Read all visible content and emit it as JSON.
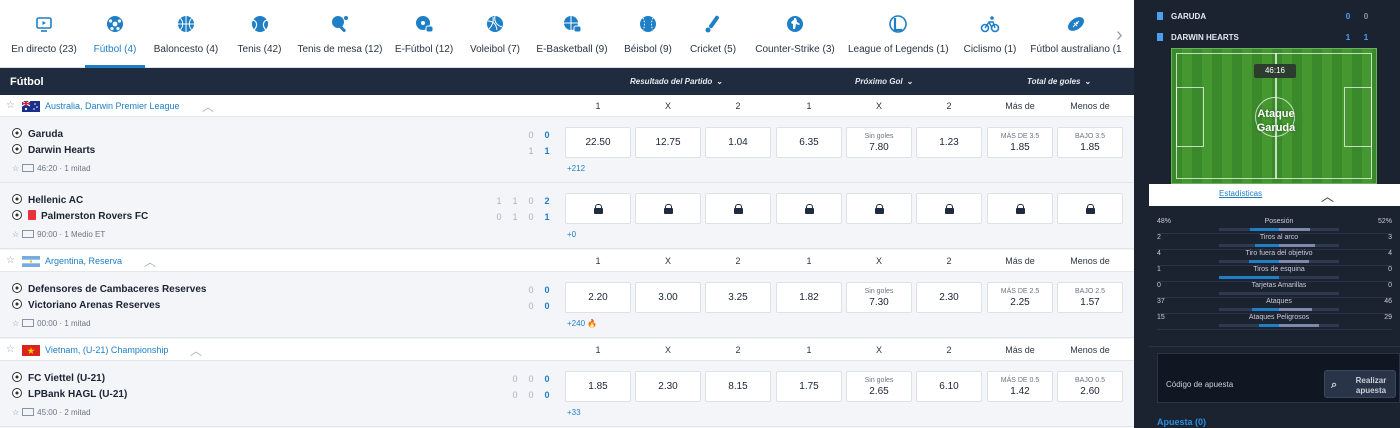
{
  "sports_nav": [
    {
      "label": "En directo (23)",
      "icon": "live-tv-icon"
    },
    {
      "label": "Fútbol (4)",
      "icon": "soccer-ball-icon",
      "active": true
    },
    {
      "label": "Baloncesto (4)",
      "icon": "basketball-icon"
    },
    {
      "label": "Tenis (42)",
      "icon": "tennis-ball-icon"
    },
    {
      "label": "Tenis de mesa (12)",
      "icon": "table-tennis-icon"
    },
    {
      "label": "E-Fútbol (12)",
      "icon": "esoccer-icon"
    },
    {
      "label": "Voleibol (7)",
      "icon": "volleyball-icon"
    },
    {
      "label": "E-Basketball (9)",
      "icon": "ebasketball-icon"
    },
    {
      "label": "Béisbol (9)",
      "icon": "baseball-icon"
    },
    {
      "label": "Cricket (5)",
      "icon": "cricket-icon"
    },
    {
      "label": "Counter-Strike (3)",
      "icon": "counter-strike-icon"
    },
    {
      "label": "League of Legends (1)",
      "icon": "league-of-legends-icon"
    },
    {
      "label": "Ciclismo (1)",
      "icon": "cycling-icon"
    },
    {
      "label": "Fútbol australiano (1",
      "icon": "australian-football-icon"
    }
  ],
  "market_header": {
    "title": "Fútbol",
    "markets": [
      "Resultado del Partido",
      "Próximo Gol",
      "Total de goles"
    ]
  },
  "leagues": [
    {
      "name": "Australia, Darwin Premier League",
      "flag": "australia",
      "columns": [
        "1",
        "X",
        "2",
        "1",
        "X",
        "2",
        "Más de",
        "Menos de"
      ]
    },
    {
      "name": "Argentina, Reserva",
      "flag": "argentina",
      "columns": [
        "1",
        "X",
        "2",
        "1",
        "X",
        "2",
        "Más de",
        "Menos de"
      ]
    },
    {
      "name": "Vietnam, (U-21) Championship",
      "flag": "vietnam",
      "columns": [
        "1",
        "X",
        "2",
        "1",
        "X",
        "2",
        "Más de",
        "Menos de"
      ]
    }
  ],
  "events": [
    {
      "home": "Garuda",
      "away": "Darwin Hearts",
      "time": "46:20",
      "period": "1 mitad",
      "home_scores": [
        "0",
        "0"
      ],
      "away_scores": [
        "1",
        "1"
      ],
      "odds": [
        {
          "v": "22.50"
        },
        {
          "v": "12.75"
        },
        {
          "v": "1.04"
        },
        {
          "v": "6.35"
        },
        {
          "sub": "Sin goles",
          "v": "7.80"
        },
        {
          "v": "1.23"
        },
        {
          "sub": "MÁS DE 3.5",
          "v": "1.85"
        },
        {
          "sub": "BAJO 3.5",
          "v": "1.85"
        }
      ],
      "more": "+212"
    },
    {
      "home": "Hellenic AC",
      "away": "Palmerston Rovers FC",
      "time": "90:00",
      "period": "1 Medio ET",
      "home_scores": [
        "1",
        "1",
        "0",
        "2"
      ],
      "away_scores": [
        "0",
        "1",
        "0",
        "1"
      ],
      "locked": true,
      "more": "+0"
    },
    {
      "home": "Defensores de Cambaceres Reserves",
      "away": "Victoriano Arenas Reserves",
      "time": "00:00",
      "period": "1 mitad",
      "home_scores": [
        "0",
        "0"
      ],
      "away_scores": [
        "0",
        "0"
      ],
      "odds": [
        {
          "v": "2.20"
        },
        {
          "v": "3.00"
        },
        {
          "v": "3.25"
        },
        {
          "v": "1.82"
        },
        {
          "sub": "Sin goles",
          "v": "7.30"
        },
        {
          "v": "2.30"
        },
        {
          "sub": "MÁS DE 2.5",
          "v": "2.25"
        },
        {
          "sub": "BAJO 2.5",
          "v": "1.57"
        }
      ],
      "more": "+240"
    },
    {
      "home": "FC Viettel (U-21)",
      "away": "LPBank HAGL (U-21)",
      "time": "45:00",
      "period": "2 mitad",
      "home_scores": [
        "0",
        "0",
        "0"
      ],
      "away_scores": [
        "0",
        "0",
        "0"
      ],
      "odds": [
        {
          "v": "1.85"
        },
        {
          "v": "2.30"
        },
        {
          "v": "8.15"
        },
        {
          "v": "1.75"
        },
        {
          "sub": "Sin goles",
          "v": "2.65"
        },
        {
          "v": "6.10"
        },
        {
          "sub": "MÁS DE 0.5",
          "v": "1.42"
        },
        {
          "sub": "BAJO 0.5",
          "v": "2.60"
        }
      ],
      "more": "+33"
    }
  ],
  "live_tracker": {
    "home": {
      "name": "GARUDA",
      "score": "0",
      "half": "0"
    },
    "away": {
      "name": "DARWIN HEARTS",
      "score": "1",
      "half": "1"
    },
    "clock": "46:16",
    "attack": "Ataque Garuda",
    "stats_link": "Estadísticas"
  },
  "stats": [
    {
      "name": "Posesión",
      "home": "48%",
      "away": "52%",
      "home_frac": 0.48,
      "away_frac": 0.52
    },
    {
      "name": "Tiros al arco",
      "home": "2",
      "away": "3",
      "home_frac": 0.4,
      "away_frac": 0.6
    },
    {
      "name": "Tiro fuera del objetivo",
      "home": "4",
      "away": "4",
      "home_frac": 0.5,
      "away_frac": 0.5
    },
    {
      "name": "Tiros de esquina",
      "home": "1",
      "away": "0",
      "home_frac": 1.0,
      "away_frac": 0.0
    },
    {
      "name": "Tarjetas Amarillas",
      "home": "0",
      "away": "0",
      "home_frac": 0.0,
      "away_frac": 0.0
    },
    {
      "name": "Ataques",
      "home": "37",
      "away": "46",
      "home_frac": 0.45,
      "away_frac": 0.55
    },
    {
      "name": "Ataques Peligrosos",
      "home": "15",
      "away": "29",
      "home_frac": 0.34,
      "away_frac": 0.66
    }
  ],
  "betslip": {
    "code_placeholder": "Código de apuesta",
    "submit": "Realizar apuesta",
    "bet_count": "Apuesta (0)"
  },
  "colors": {
    "accent": "#1e7fc6",
    "header": "#1f2b3e",
    "sidebar": "#1b2230"
  }
}
